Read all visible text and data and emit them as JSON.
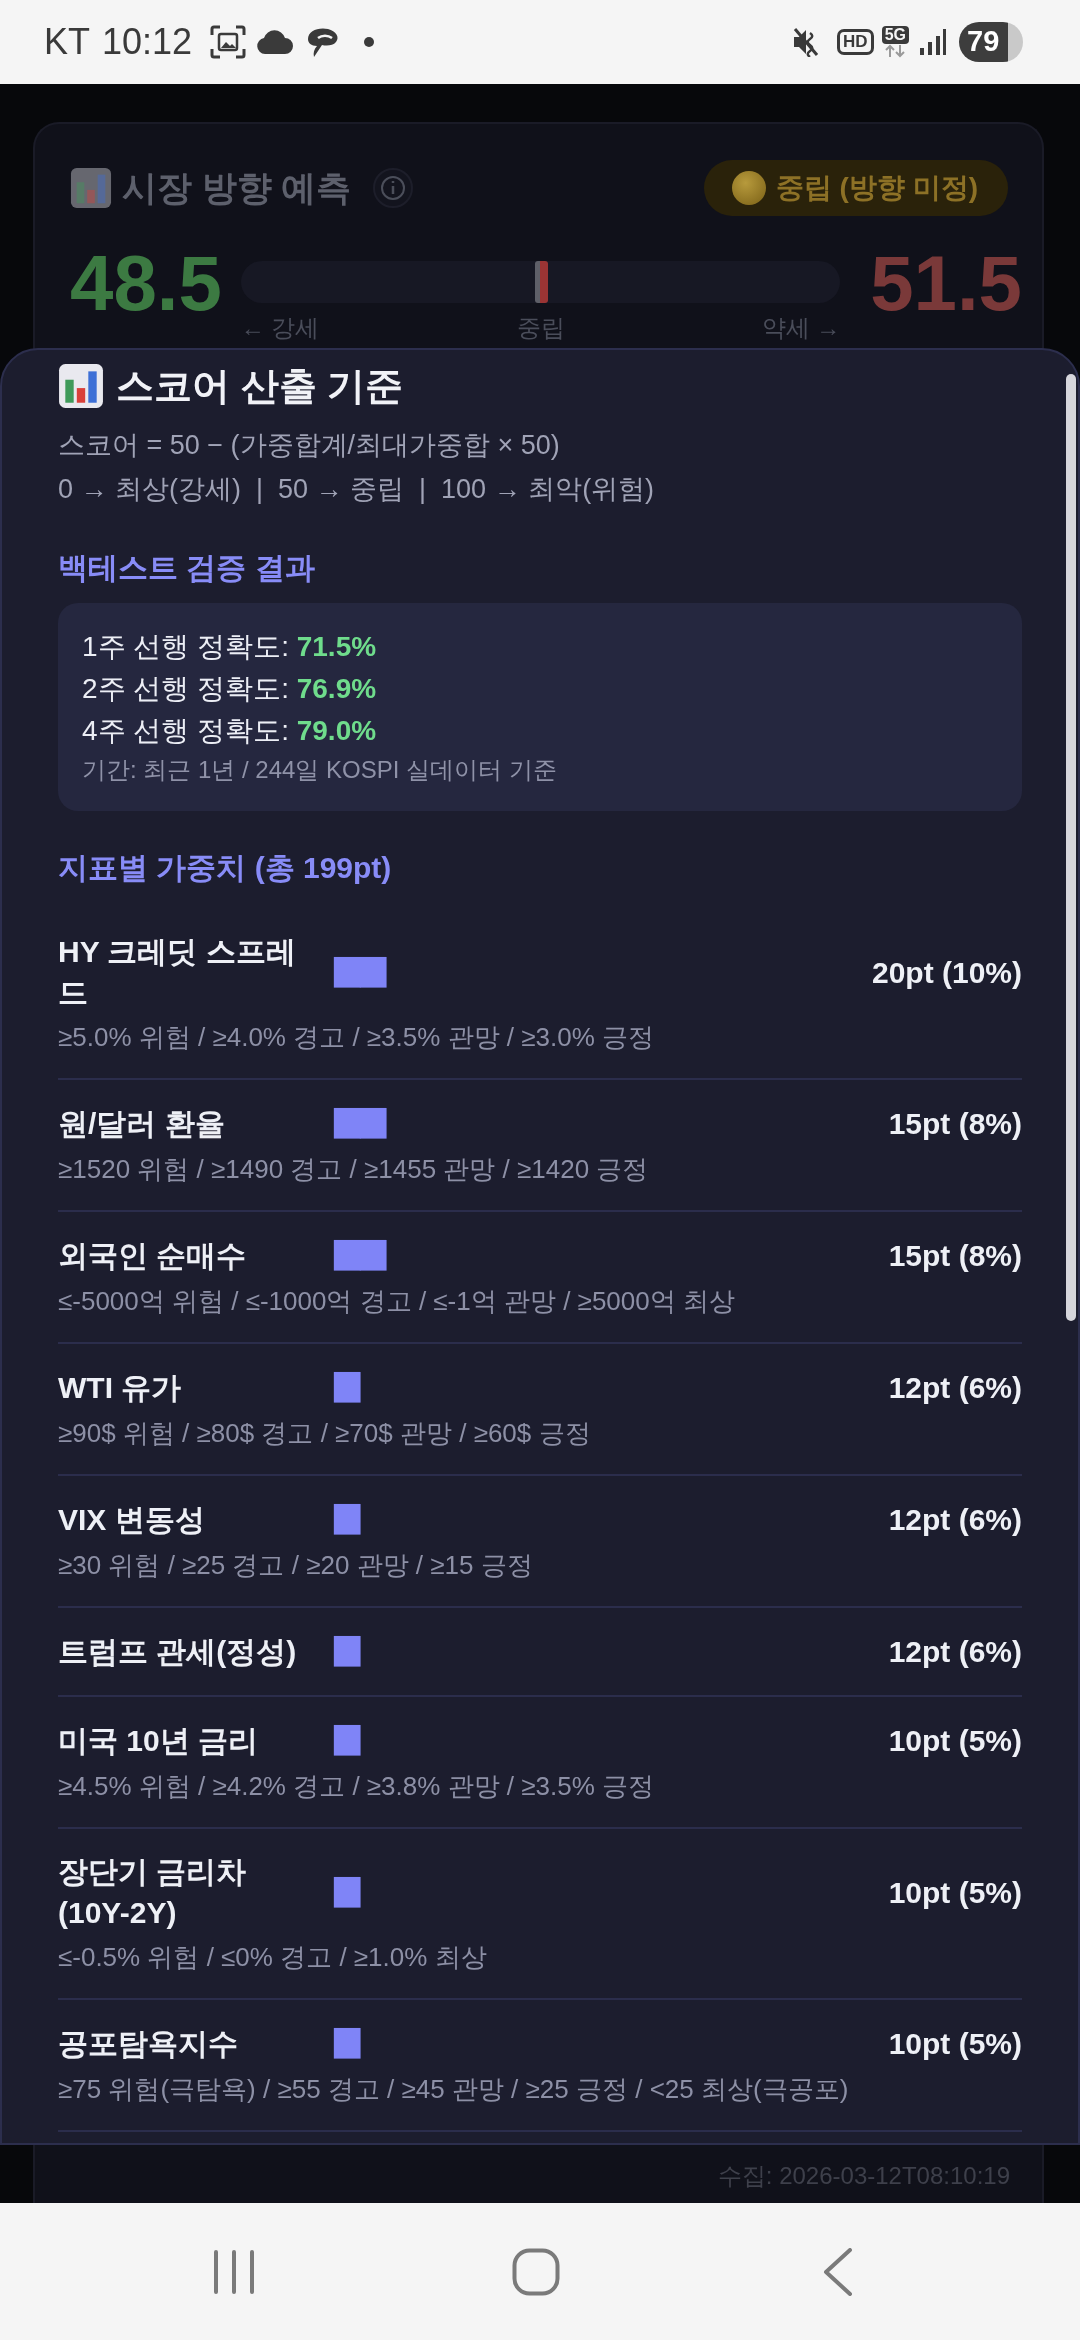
{
  "status_bar": {
    "carrier": "KT",
    "time": "10:12",
    "hd": "HD",
    "network": "5G",
    "battery": "79"
  },
  "background_card": {
    "title": "시장 방향 예측",
    "badge": "중립 (방향 미정)",
    "left_score": "48.5",
    "right_score": "51.5",
    "gauge": {
      "level": 0.5,
      "left_label": "← 강세",
      "center_label": "중립",
      "right_label": "약세 →"
    },
    "collected": "수집: 2026-03-12T08:10:19"
  },
  "sheet": {
    "title": "스코어 산출 기준",
    "formula": "스코어 = 50 − (가중합계/최대가중합 × 50)",
    "scale": "0 → 최상(강세)  |  50 → 중립  |  100 → 최악(위험)",
    "backtest": {
      "heading": "백테스트 검증 결과",
      "results": [
        {
          "label": "1주 선행 정확도:",
          "value": "71.5%"
        },
        {
          "label": "2주 선행 정확도:",
          "value": "76.9%"
        },
        {
          "label": "4주 선행 정확도:",
          "value": "79.0%"
        }
      ],
      "period": "기간: 최근 1년 / 244일 KOSPI 실데이터 기준"
    },
    "weights": {
      "heading": "지표별 가중치 (총 199pt)",
      "items": [
        {
          "name": "HY 크레딧 스프레드",
          "bar": "██",
          "weight": "20pt (10%)",
          "thresholds": "≥5.0% 위험 / ≥4.0% 경고 / ≥3.5% 관망 / ≥3.0% 긍정"
        },
        {
          "name": "원/달러 환율",
          "bar": "██",
          "weight": "15pt (8%)",
          "thresholds": "≥1520 위험 / ≥1490 경고 / ≥1455 관망 / ≥1420 긍정"
        },
        {
          "name": "외국인 순매수",
          "bar": "██",
          "weight": "15pt (8%)",
          "thresholds": "≤-5000억 위험 / ≤-1000억 경고 / ≤-1억 관망 / ≥5000억 최상"
        },
        {
          "name": "WTI 유가",
          "bar": "█",
          "weight": "12pt (6%)",
          "thresholds": "≥90$ 위험 / ≥80$ 경고 / ≥70$ 관망 / ≥60$ 긍정"
        },
        {
          "name": "VIX 변동성",
          "bar": "█",
          "weight": "12pt (6%)",
          "thresholds": "≥30 위험 / ≥25 경고 / ≥20 관망 / ≥15 긍정"
        },
        {
          "name": "트럼프 관세(정성)",
          "bar": "█",
          "weight": "12pt (6%)"
        },
        {
          "name": "미국 10년 금리",
          "bar": "█",
          "weight": "10pt (5%)",
          "thresholds": "≥4.5% 위험 / ≥4.2% 경고 / ≥3.8% 관망 / ≥3.5% 긍정"
        },
        {
          "name": "장단기 금리차 (10Y-2Y)",
          "bar": "█",
          "weight": "10pt (5%)",
          "thresholds": "≤-0.5% 위험 / ≤0% 경고 / ≥1.0% 최상"
        },
        {
          "name": "공포탐욕지수",
          "bar": "█",
          "weight": "10pt (5%)",
          "thresholds": "≥75 위험(극탐욕) / ≥55 경고 / ≥45 관망 / ≥25 긍정 / <25 최상(극공포)"
        }
      ]
    }
  }
}
